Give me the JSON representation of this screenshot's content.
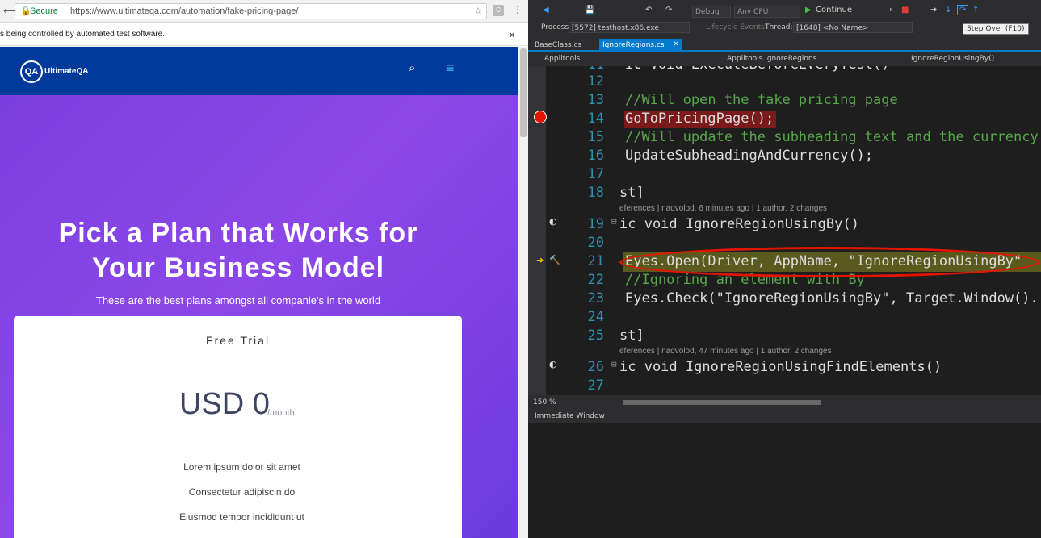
{
  "browser": {
    "secure_label": "Secure",
    "url": "https://www.ultimateqa.com/automation/fake-pricing-page/",
    "info_text": "s being controlled by automated test software.",
    "close_glyph": "×"
  },
  "site": {
    "logo_text": "UltimateQA",
    "logo_badge": "QA",
    "hero_title": "Pick a Plan that Works for Your Business Model",
    "hero_subtitle": "These are the best plans amongst all companie's in the world",
    "plan": {
      "name": "Free Trial",
      "price": "USD 0",
      "period": "/month",
      "features": [
        "Lorem ipsum dolor sit amet",
        "Consectetur adipiscin do",
        "Eiusmod tempor incididunt ut"
      ]
    }
  },
  "vs": {
    "config": "Debug",
    "platform": "Any CPU",
    "continue_label": "Continue",
    "process_label": "Process:",
    "process_value": "[5572] testhost.x86.exe",
    "lifecycle_label": "Lifecycle Events",
    "thread_label": "Thread:",
    "thread_value": "[1648] <No Name>",
    "tooltip": "Step Over (F10)",
    "tabs": [
      {
        "label": "BaseClass.cs",
        "active": false
      },
      {
        "label": "IgnoreRegions.cs",
        "active": true
      }
    ],
    "nav": [
      "Applitools",
      "Applitools.IgnoreRegions",
      "IgnoreRegionUsingBy()"
    ],
    "zoom": "150 %",
    "immediate_title": "Immediate Window",
    "code": [
      {
        "n": "11",
        "t": "ic void ExecuteBeforeEveryTest()"
      },
      {
        "n": "12",
        "t": ""
      },
      {
        "n": "13",
        "t": "//Will open the fake pricing page"
      },
      {
        "n": "14",
        "t": "GoToPricingPage();"
      },
      {
        "n": "15",
        "t": "//Will update the subheading text and the currency"
      },
      {
        "n": "16",
        "t": "UpdateSubheadingAndCurrency();"
      },
      {
        "n": "17",
        "t": ""
      },
      {
        "n": "18",
        "t": "st]"
      },
      {
        "n": "19",
        "t": "ic void IgnoreRegionUsingBy()"
      },
      {
        "n": "20",
        "t": ""
      },
      {
        "n": "21",
        "t": "Eyes.Open(Driver, AppName, \"IgnoreRegionUsingBy\""
      },
      {
        "n": "22",
        "t": "//Ignoring an element with By"
      },
      {
        "n": "23",
        "t": "Eyes.Check(\"IgnoreRegionUsingBy\", Target.Window()."
      },
      {
        "n": "24",
        "t": ""
      },
      {
        "n": "25",
        "t": "st]"
      },
      {
        "n": "26",
        "t": "ic void IgnoreRegionUsingFindElements()"
      },
      {
        "n": "27",
        "t": ""
      }
    ],
    "lens1": "eferences | nadvolod, 6 minutes ago | 1 author, 2 changes",
    "lens2": "eferences | nadvolod, 47 minutes ago | 1 author, 2 changes"
  },
  "colors": {
    "site_header": "#023a9c",
    "hero_purple": "#7a3fe0",
    "highlight_red": "#e51400",
    "current_line": "#5a5a1e"
  }
}
